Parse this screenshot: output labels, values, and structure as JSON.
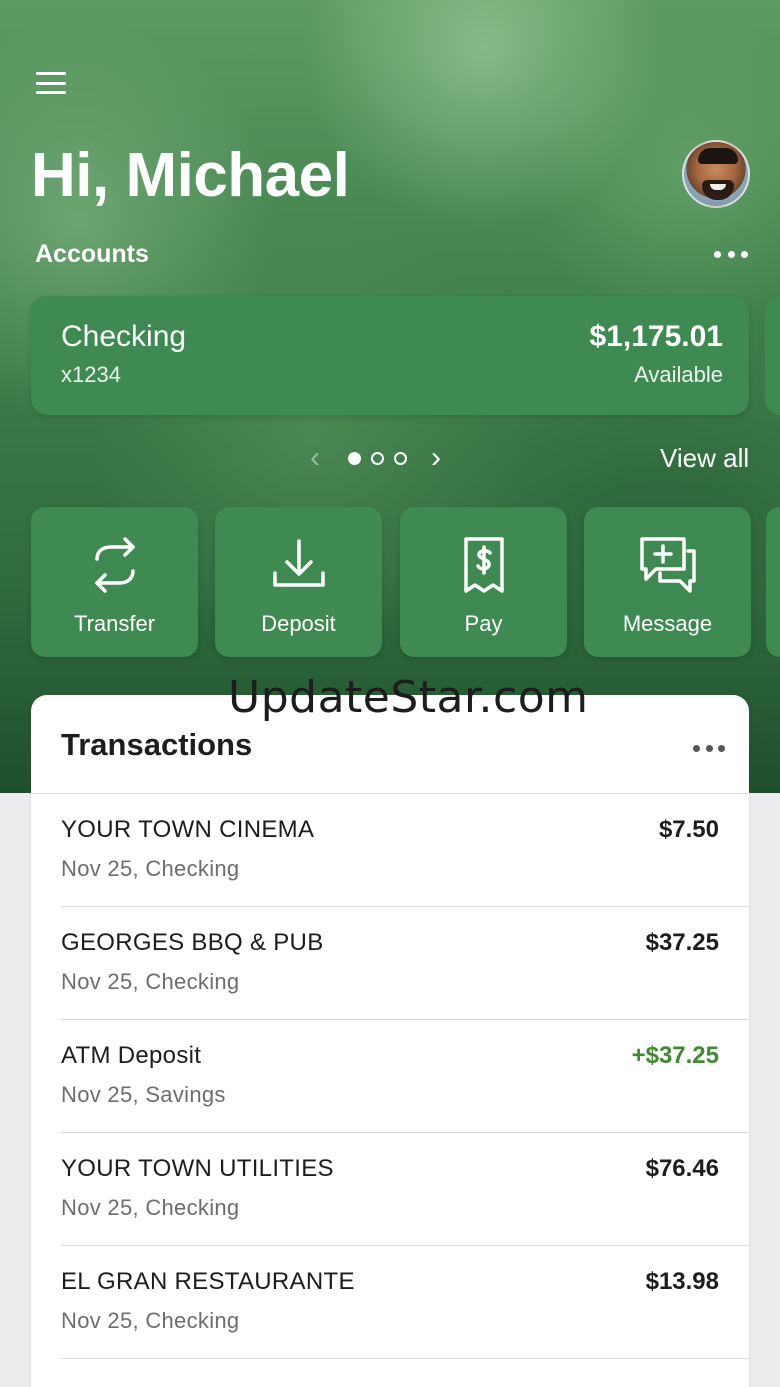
{
  "header": {
    "greeting": "Hi, Michael",
    "menu_icon": "hamburger-menu-icon",
    "avatar_icon": "profile-avatar"
  },
  "accounts": {
    "label": "Accounts",
    "more_icon": "ellipsis-icon",
    "card": {
      "name": "Checking",
      "number": "x1234",
      "balance": "$1,175.01",
      "balance_label": "Available"
    },
    "pager": {
      "total": 3,
      "active": 1
    },
    "view_all": "View all"
  },
  "actions": [
    {
      "label": "Transfer",
      "icon": "transfer-arrows-icon"
    },
    {
      "label": "Deposit",
      "icon": "deposit-download-icon"
    },
    {
      "label": "Pay",
      "icon": "bill-receipt-dollar-icon"
    },
    {
      "label": "Message",
      "icon": "message-plus-icon"
    }
  ],
  "watermark": "UpdateStar.com",
  "transactions": {
    "title": "Transactions",
    "items": [
      {
        "merchant": "YOUR TOWN CINEMA",
        "date_account": "Nov 25, Checking",
        "amount": "$7.50",
        "credit": false
      },
      {
        "merchant": "GEORGES BBQ & PUB",
        "date_account": "Nov 25, Checking",
        "amount": "$37.25",
        "credit": false
      },
      {
        "merchant": "ATM Deposit",
        "date_account": "Nov 25, Savings",
        "amount": "+$37.25",
        "credit": true
      },
      {
        "merchant": "YOUR TOWN UTILITIES",
        "date_account": "Nov 25, Checking",
        "amount": "$76.46",
        "credit": false
      },
      {
        "merchant": "EL GRAN RESTAURANTE",
        "date_account": "Nov 25, Checking",
        "amount": "$13.98",
        "credit": false
      }
    ]
  },
  "colors": {
    "card_green": "#3f8a52",
    "credit_green": "#3e8a2f",
    "text_dark": "#1d1d1f",
    "text_muted": "#6d6d6d"
  }
}
